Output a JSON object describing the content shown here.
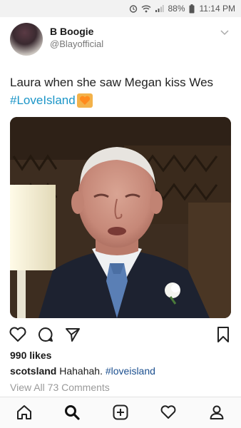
{
  "status_bar": {
    "battery": "88%",
    "time": "11:14 PM",
    "icons": [
      "alarm-icon",
      "wifi-icon",
      "signal-icon",
      "battery-icon"
    ]
  },
  "post": {
    "display_name": "B Boogie",
    "handle": "@Blayofficial",
    "text": "Laura when she saw Megan kiss Wes",
    "hashtag": "#LoveIsland",
    "emoji": "orange-heart-emoji"
  },
  "actions": {
    "icons": [
      "heart-icon",
      "comment-icon",
      "share-icon",
      "bookmark-icon"
    ]
  },
  "engagement": {
    "likes": "990 likes",
    "caption_user": "scotsland",
    "caption_text": "Hahahah.",
    "caption_tag": "#loveisland",
    "comments_link": "View All 73 Comments"
  },
  "bottom_nav": {
    "items": [
      "home-icon",
      "search-icon",
      "add-post-icon",
      "activity-heart-icon",
      "profile-icon"
    ],
    "active": "search-icon"
  },
  "colors": {
    "hashtag": "#1b95c7",
    "caption_tag": "#1b4f8f",
    "muted": "#9a9a9a"
  }
}
